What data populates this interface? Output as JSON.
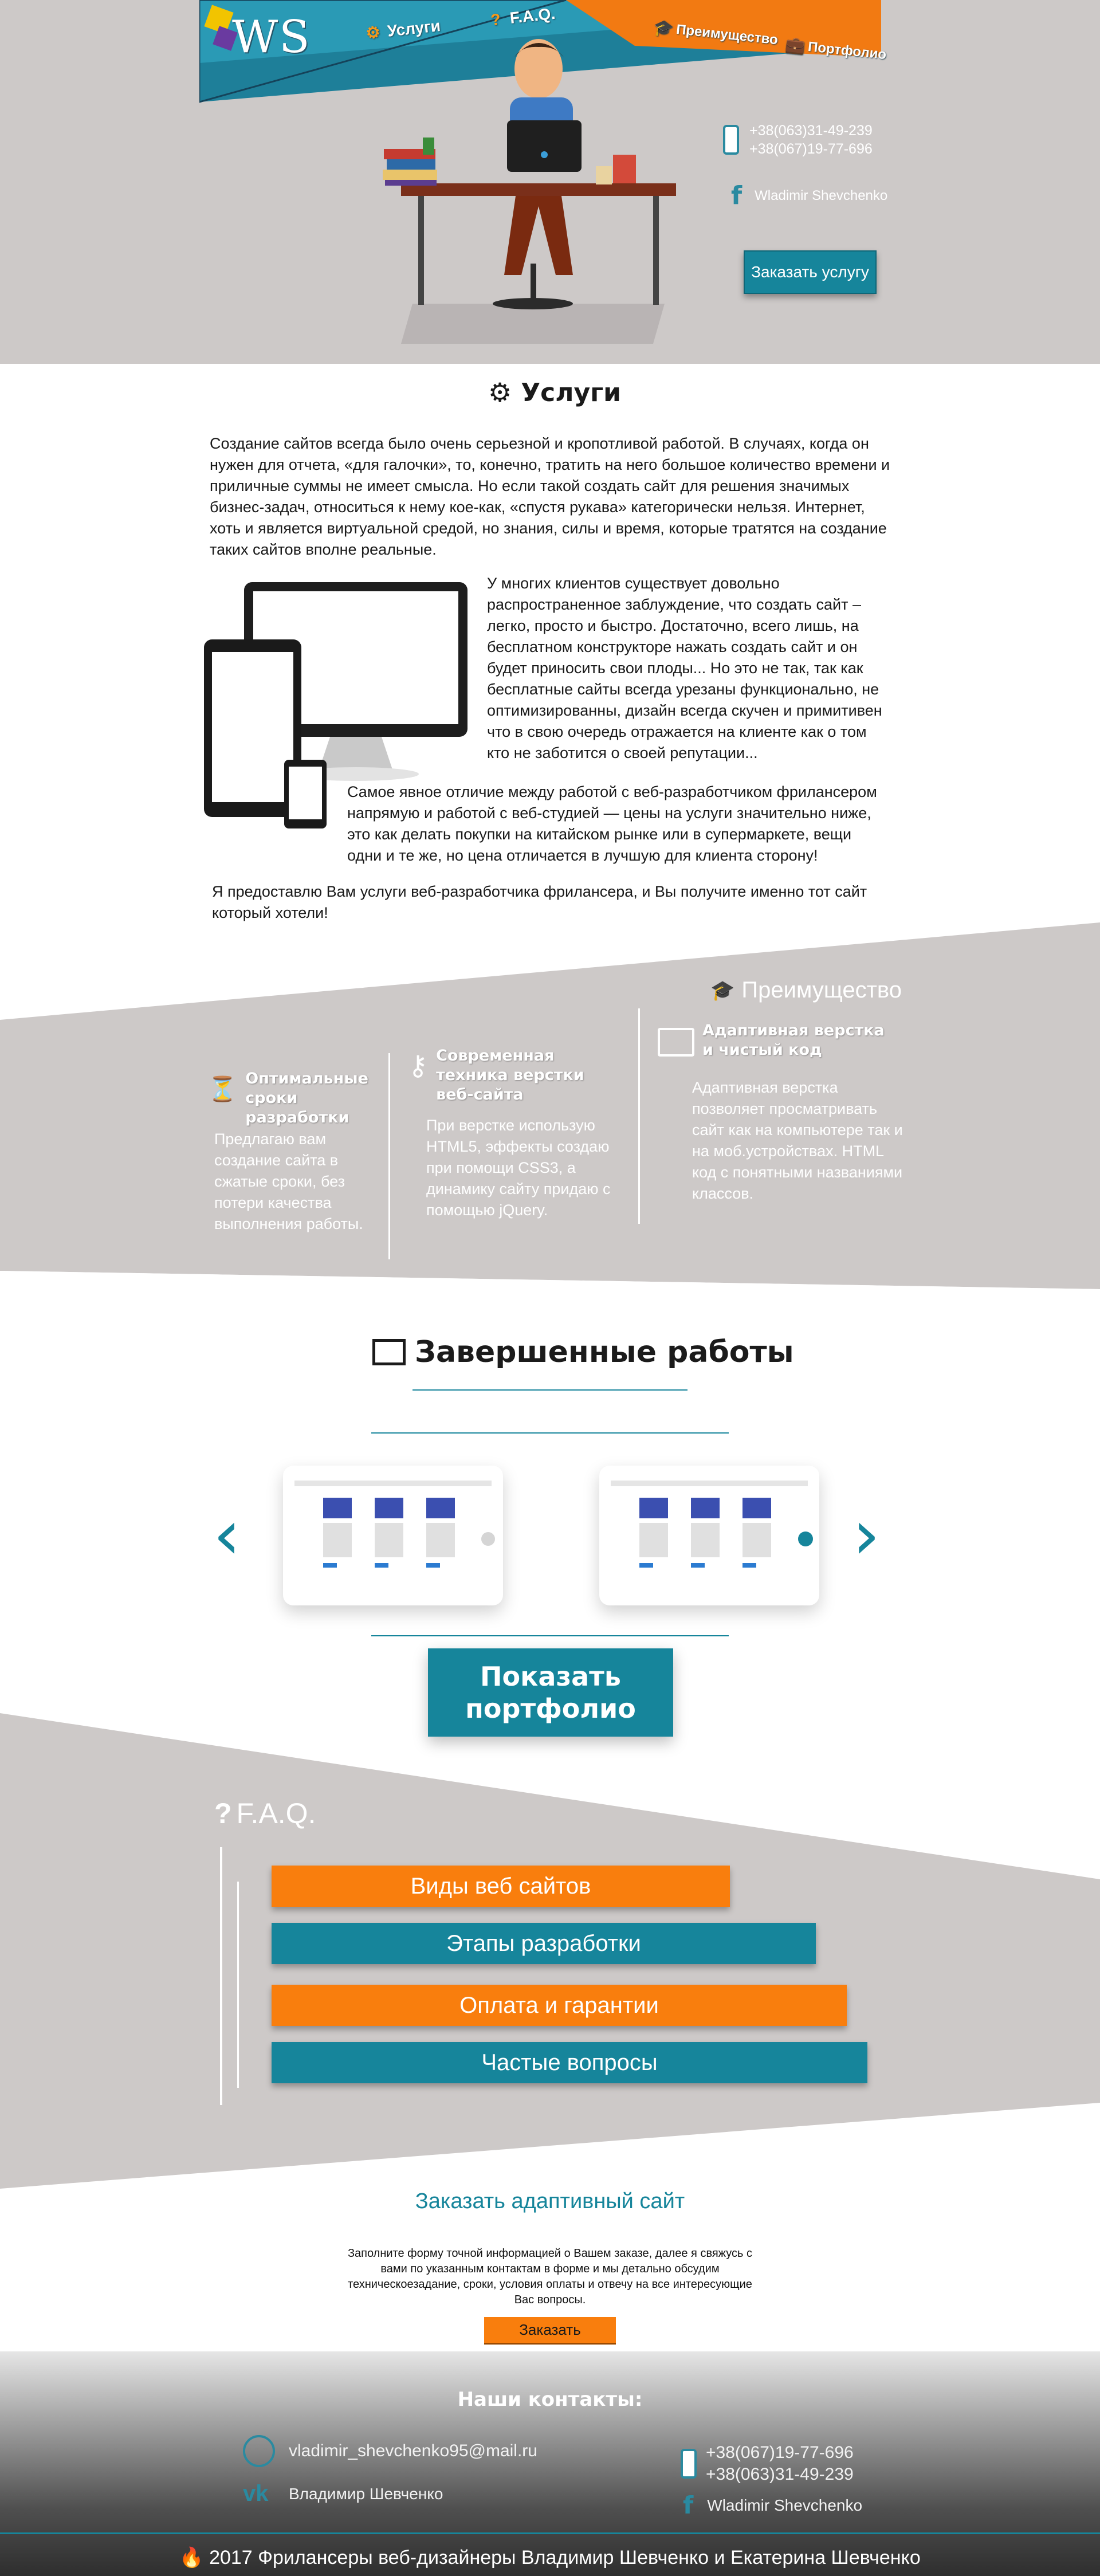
{
  "nav": {
    "logo": "WS",
    "items": [
      {
        "label": "Услуги",
        "icon": "gear-icon"
      },
      {
        "label": "F.A.Q.",
        "icon": "question-icon"
      },
      {
        "label": "Преимущество",
        "icon": "graduation-cap-icon"
      },
      {
        "label": "Портфолио",
        "icon": "briefcase-icon"
      }
    ]
  },
  "hero": {
    "phone1": "+38(063)31-49-239",
    "phone2": "+38(067)19-77-696",
    "facebook": "Wladimir Shevchenko",
    "order_button": "Заказать услугу"
  },
  "services": {
    "title": "Услуги",
    "p1": "Создание сайтов всегда было очень серьезной и кропотливой работой. В случаях, когда он нужен для отчета, «для галочки», то, конечно, тратить на него большое количество времени и приличные суммы не имеет смысла. Но если такой создать сайт для решения значимых бизнес-задач, относиться к нему кое-как, «спустя рукава» категорически нельзя. Интернет, хоть и является виртуальной средой, но знания, силы и время, которые тратятся на создание таких сайтов вполне реальные.",
    "p2": "У многих клиентов существует довольно распространенное заблуждение, что создать сайт – легко, просто и быстро. Достаточно, всего лишь, на бесплатном конструкторе нажать создать сайт и он будет приносить свои плоды... Но это не так, так как бесплатные сайты всегда урезаны функционально, не оптимизированны, дизайн всегда скучен и примитивен что в свою очередь отражается на клиенте как о том кто не заботится о своей репутации...",
    "p3": "Самое явное отличие между работой с веб-разработчиком фрилансером напрямую и работой с веб-студией — цены на услуги значительно ниже, это как делать покупки на китайском рынке или в супермаркете, вещи одни и те же, но цена отличается в лучшую для клиента сторону!",
    "p4": "Я предоставлю Вам услуги веб-разработчика фрилансера, и Вы получите именно тот сайт который хотели!"
  },
  "advantages": {
    "title": "Преимущество",
    "items": [
      {
        "heading": "Оптимальные сроки разработки",
        "body": "Предлагаю вам создание сайта в сжатые сроки, без потери качества выполнения работы.",
        "icon": "hourglass-icon"
      },
      {
        "heading": "Современная техника верстки веб-сайта",
        "body": "При верстке использую HTML5, эффекты создаю при помощи CSS3, а динамику сайту придаю с помощью jQuery.",
        "icon": "key-icon"
      },
      {
        "heading": "Адаптивная верстка и чистый код",
        "body": "Адаптивная верстка позволяет просматривать сайт как на компьютере так и на моб.устройствах. HTML код с понятными названиями классов.",
        "icon": "monitor-icon"
      }
    ]
  },
  "works": {
    "title": "Завершенные работы",
    "button": "Показать портфолио"
  },
  "faq": {
    "title": "F.A.Q.",
    "items": [
      "Виды веб сайтов",
      "Этапы разработки",
      "Оплата и гарантии",
      "Частые вопросы"
    ]
  },
  "order": {
    "title": "Заказать адаптивный сайт",
    "description": "Заполните форму точной информацией о Вашем заказе, далее я свяжусь с вами по указанным контактам в форме и мы детально обсудим техническоезадание, сроки, условия оплаты и отвечу на все интересующие Вас вопросы.",
    "button": "Заказать"
  },
  "footer": {
    "title": "Наши контакты:",
    "email": "vladimir_shevchenko95@mail.ru",
    "vk": "Владимир Шевченко",
    "phone1": "+38(067)19-77-696",
    "phone2": "+38(063)31-49-239",
    "facebook": "Wladimir Shevchenko",
    "copyright": "2017 Фрилансеры веб-дизайнеры Владимир Шевченко и Екатерина Шевченко"
  },
  "colors": {
    "teal": "#16859b",
    "orange": "#f97e0d",
    "grey": "#cdc9c8"
  }
}
